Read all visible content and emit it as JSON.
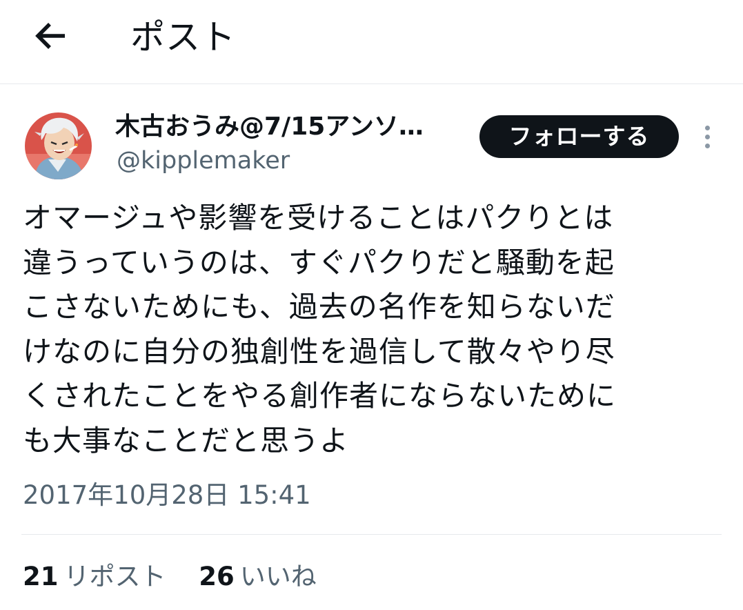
{
  "header": {
    "title": "ポスト",
    "back_icon": "arrow-left-icon"
  },
  "author": {
    "display_name": "木古おうみ@7/15アンソ…",
    "handle": "@kipplemaker",
    "avatar_bg": "#d9534a"
  },
  "actions": {
    "follow_label": "フォローする",
    "more_icon": "more-vertical-icon"
  },
  "post": {
    "text": "オマージュや影響を受けることはパクりとは\n違うっていうのは、すぐパクりだと騒動を起\nこさないためにも、過去の名作を知らないだ\nけなのに自分の独創性を過信して散々やり尽\nくされたことをやる創作者にならないために\nも大事なことだと思うよ",
    "timestamp": "2017年10月28日 15:41"
  },
  "stats": {
    "reposts_count": "21",
    "reposts_label": "リポスト",
    "likes_count": "26",
    "likes_label": "いいね"
  },
  "colors": {
    "text_primary": "#0f1419",
    "text_secondary": "#536471",
    "border": "#e6e9ec",
    "button_bg": "#0f1419"
  }
}
